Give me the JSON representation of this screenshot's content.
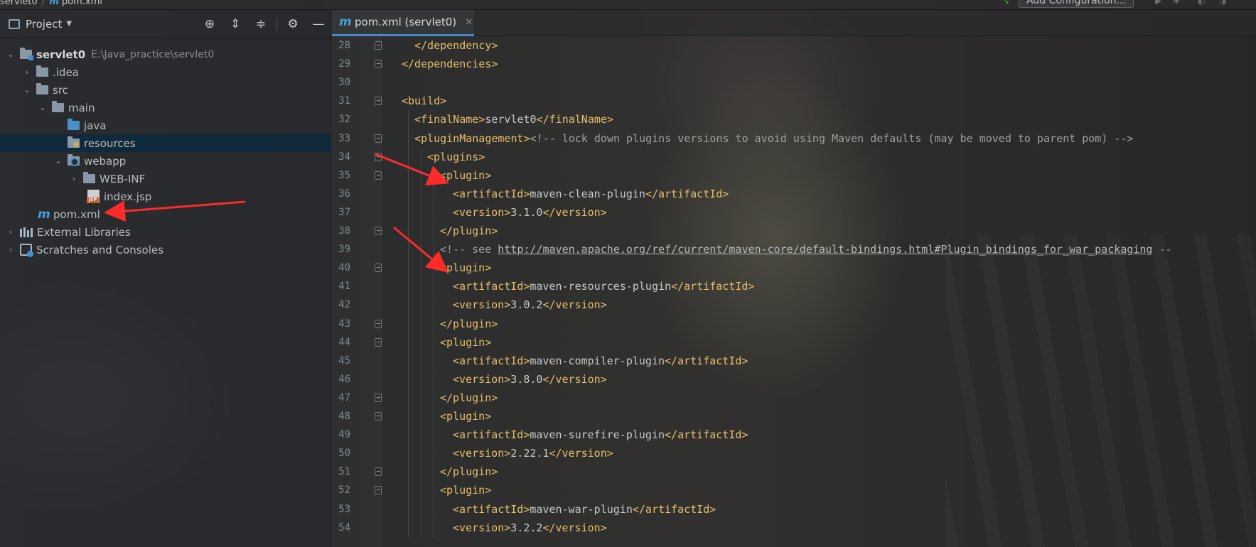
{
  "topbar": {
    "crumb_project": "servlet0",
    "crumb_file": "pom.xml",
    "add_configuration": "Add Configuration..."
  },
  "project_panel": {
    "title": "Project",
    "tree": [
      {
        "label": "servlet0",
        "path": "E:\\Java_practice\\servlet0"
      },
      {
        "label": ".idea"
      },
      {
        "label": "src"
      },
      {
        "label": "main"
      },
      {
        "label": "java"
      },
      {
        "label": "resources"
      },
      {
        "label": "webapp"
      },
      {
        "label": "WEB-INF"
      },
      {
        "label": "index.jsp"
      },
      {
        "label": "pom.xml"
      },
      {
        "label": "External Libraries"
      },
      {
        "label": "Scratches and Consoles"
      }
    ]
  },
  "editor": {
    "tab_label": "pom.xml (servlet0)",
    "lines": [
      {
        "n": "28",
        "indent": 1,
        "parts": [
          [
            "t",
            "</dependency>"
          ]
        ]
      },
      {
        "n": "29",
        "indent": 0,
        "parts": [
          [
            "t",
            "</dependencies>"
          ]
        ]
      },
      {
        "n": "30",
        "indent": 0,
        "parts": []
      },
      {
        "n": "31",
        "indent": 0,
        "parts": [
          [
            "t",
            "<build>"
          ]
        ]
      },
      {
        "n": "32",
        "indent": 1,
        "parts": [
          [
            "t",
            "<finalName>"
          ],
          [
            "x",
            "servlet0"
          ],
          [
            "t",
            "</finalName>"
          ]
        ]
      },
      {
        "n": "33",
        "indent": 1,
        "parts": [
          [
            "t",
            "<pluginManagement>"
          ],
          [
            "c",
            "<!-- lock down plugins versions to avoid using Maven defaults (may be moved to parent pom) -->"
          ]
        ]
      },
      {
        "n": "34",
        "indent": 2,
        "parts": [
          [
            "t",
            "<plugins>"
          ]
        ]
      },
      {
        "n": "35",
        "indent": 3,
        "parts": [
          [
            "t",
            "<plugin>"
          ]
        ]
      },
      {
        "n": "36",
        "indent": 4,
        "parts": [
          [
            "t",
            "<artifactId>"
          ],
          [
            "x",
            "maven-clean-plugin"
          ],
          [
            "t",
            "</artifactId>"
          ]
        ]
      },
      {
        "n": "37",
        "indent": 4,
        "parts": [
          [
            "t",
            "<version>"
          ],
          [
            "x",
            "3.1.0"
          ],
          [
            "t",
            "</version>"
          ]
        ]
      },
      {
        "n": "38",
        "indent": 3,
        "parts": [
          [
            "t",
            "</plugin>"
          ]
        ]
      },
      {
        "n": "39",
        "indent": 3,
        "parts": [
          [
            "c",
            "<!-- see "
          ],
          [
            "u",
            "http://maven.apache.org/ref/current/maven-core/default-bindings.html#Plugin_bindings_for_war_packaging"
          ],
          [
            "c",
            " --"
          ]
        ]
      },
      {
        "n": "40",
        "indent": 3,
        "parts": [
          [
            "t",
            "<plugin>"
          ]
        ]
      },
      {
        "n": "41",
        "indent": 4,
        "parts": [
          [
            "t",
            "<artifactId>"
          ],
          [
            "x",
            "maven-resources-plugin"
          ],
          [
            "t",
            "</artifactId>"
          ]
        ]
      },
      {
        "n": "42",
        "indent": 4,
        "parts": [
          [
            "t",
            "<version>"
          ],
          [
            "x",
            "3.0.2"
          ],
          [
            "t",
            "</version>"
          ]
        ]
      },
      {
        "n": "43",
        "indent": 3,
        "parts": [
          [
            "t",
            "</plugin>"
          ]
        ]
      },
      {
        "n": "44",
        "indent": 3,
        "parts": [
          [
            "t",
            "<plugin>"
          ]
        ]
      },
      {
        "n": "45",
        "indent": 4,
        "parts": [
          [
            "t",
            "<artifactId>"
          ],
          [
            "x",
            "maven-compiler-plugin"
          ],
          [
            "t",
            "</artifactId>"
          ]
        ]
      },
      {
        "n": "46",
        "indent": 4,
        "parts": [
          [
            "t",
            "<version>"
          ],
          [
            "x",
            "3.8.0"
          ],
          [
            "t",
            "</version>"
          ]
        ]
      },
      {
        "n": "47",
        "indent": 3,
        "parts": [
          [
            "t",
            "</plugin>"
          ]
        ]
      },
      {
        "n": "48",
        "indent": 3,
        "parts": [
          [
            "t",
            "<plugin>"
          ]
        ]
      },
      {
        "n": "49",
        "indent": 4,
        "parts": [
          [
            "t",
            "<artifactId>"
          ],
          [
            "x",
            "maven-surefire-plugin"
          ],
          [
            "t",
            "</artifactId>"
          ]
        ]
      },
      {
        "n": "50",
        "indent": 4,
        "parts": [
          [
            "t",
            "<version>"
          ],
          [
            "x",
            "2.22.1"
          ],
          [
            "t",
            "</version>"
          ]
        ]
      },
      {
        "n": "51",
        "indent": 3,
        "parts": [
          [
            "t",
            "</plugin>"
          ]
        ]
      },
      {
        "n": "52",
        "indent": 3,
        "parts": [
          [
            "t",
            "<plugin>"
          ]
        ]
      },
      {
        "n": "53",
        "indent": 4,
        "parts": [
          [
            "t",
            "<artifactId>"
          ],
          [
            "x",
            "maven-war-plugin"
          ],
          [
            "t",
            "</artifactId>"
          ]
        ]
      },
      {
        "n": "54",
        "indent": 4,
        "parts": [
          [
            "t",
            "<version>"
          ],
          [
            "x",
            "3.2.2"
          ],
          [
            "t",
            "</version>"
          ]
        ]
      }
    ]
  },
  "colors": {
    "tag": "#e8bf6a",
    "text": "#c9c9c9",
    "comment": "#a0a0a0",
    "selection": "#0d293e",
    "maven_icon": "#4a9fd8",
    "annotation_arrow": "#ff2b2b"
  },
  "icons": [
    "project-window-icon",
    "locate-icon",
    "expand-all-icon",
    "collapse-all-icon",
    "gear-icon",
    "minimize-icon",
    "folder-icon",
    "maven-icon",
    "jsp-file-icon",
    "libraries-icon",
    "scratches-icon",
    "close-icon"
  ]
}
